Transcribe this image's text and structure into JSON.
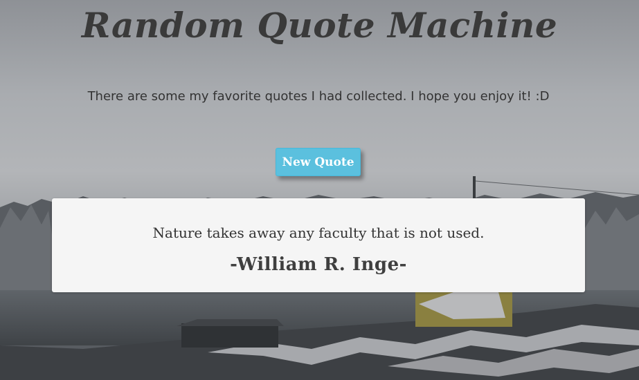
{
  "page": {
    "title": "Random Quote Machine",
    "subtitle": "There are some my favorite quotes I had collected. I hope you enjoy it! :D"
  },
  "controls": {
    "new_quote_label": "New Quote"
  },
  "quote": {
    "text": "Nature takes away any faculty that is not used.",
    "author": "-William R. Inge-"
  },
  "colors": {
    "button": "#5bc0de",
    "card": "#f5f5f5",
    "title_text": "#3a3a3a",
    "sky": "#9fa3a8"
  },
  "background": {
    "description_icon": "winter-lake-landscape-image"
  }
}
